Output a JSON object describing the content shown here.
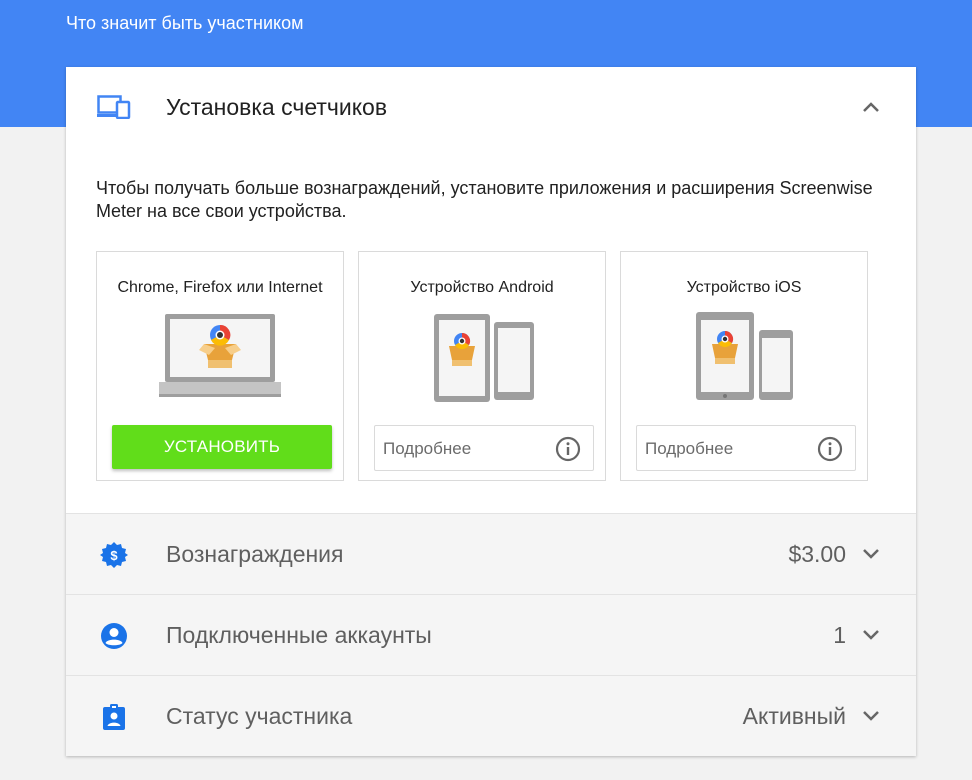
{
  "page": {
    "title": "Что значит быть участником"
  },
  "install_panel": {
    "title": "Установка счетчиков",
    "description": "Чтобы получать больше вознаграждений, установите приложения и расширения Screenwise Meter на все свои устройства.",
    "devices": [
      {
        "title": "Chrome, Firefox или Internet",
        "action_label": "УСТАНОВИТЬ",
        "icon": "laptop-illustration"
      },
      {
        "title": "Устройство Android",
        "action_label": "Подробнее",
        "icon": "android-devices-illustration"
      },
      {
        "title": "Устройство iOS",
        "action_label": "Подробнее",
        "icon": "ios-devices-illustration"
      }
    ]
  },
  "rows": [
    {
      "label": "Вознаграждения",
      "value": "$3.00",
      "icon": "reward-badge-icon"
    },
    {
      "label": "Подключенные аккаунты",
      "value": "1",
      "icon": "account-circle-icon"
    },
    {
      "label": "Статус участника",
      "value": "Активный",
      "icon": "member-badge-icon"
    }
  ],
  "colors": {
    "header": "#4285f4",
    "accent_blue": "#1a73e8",
    "install_button": "#61dd1a"
  }
}
